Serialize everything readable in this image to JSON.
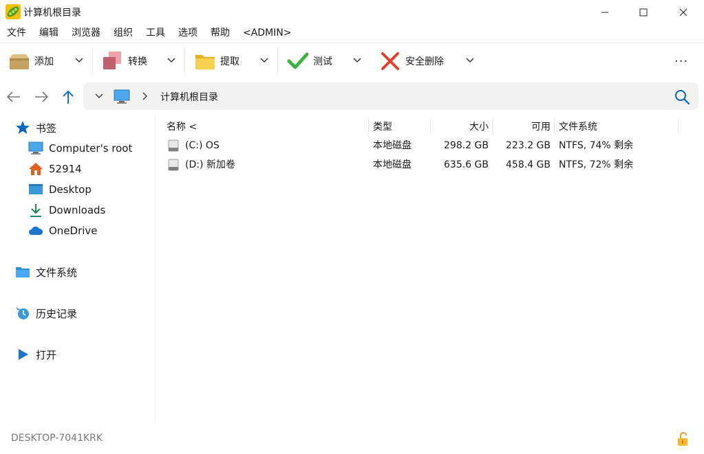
{
  "window": {
    "title": "计算机根目录"
  },
  "menu": [
    "文件",
    "编辑",
    "浏览器",
    "组织",
    "工具",
    "选项",
    "帮助",
    "<ADMIN>"
  ],
  "toolbar": {
    "add": "添加",
    "convert": "转换",
    "extract": "提取",
    "test": "测试",
    "delete": "安全删除",
    "more": "···"
  },
  "address": {
    "path": "计算机根目录"
  },
  "sidebar": {
    "bookmarks": "书签",
    "items": [
      "Computer's root",
      "52914",
      "Desktop",
      "Downloads",
      "OneDrive"
    ],
    "filesystem": "文件系统",
    "history": "历史记录",
    "open": "打开"
  },
  "columns": {
    "name": "名称 <",
    "type": "类型",
    "size": "大小",
    "free": "可用",
    "fs": "文件系统"
  },
  "rows": [
    {
      "name": "(C:) OS",
      "type": "本地磁盘",
      "size": "298.2 GB",
      "free": "223.2 GB",
      "fs": "NTFS, 74% 剩余"
    },
    {
      "name": "(D:) 新加卷",
      "type": "本地磁盘",
      "size": "635.6 GB",
      "free": "458.4 GB",
      "fs": "NTFS, 72% 剩余"
    }
  ],
  "status": {
    "computer": "DESKTOP-7041KRK"
  },
  "colors": {
    "accent": "#0067c0",
    "add": "#c8a060",
    "convert": "#c06070",
    "extract": "#f4c430",
    "test": "#3cb043",
    "delete": "#e04030",
    "bookmark_star": "#0067c0",
    "home": "#e06020"
  },
  "icons": {
    "app": "pea-pod-icon",
    "add": "box-icon",
    "convert": "convert-icon",
    "extract": "folder-icon",
    "test": "check-icon",
    "delete": "x-icon"
  }
}
